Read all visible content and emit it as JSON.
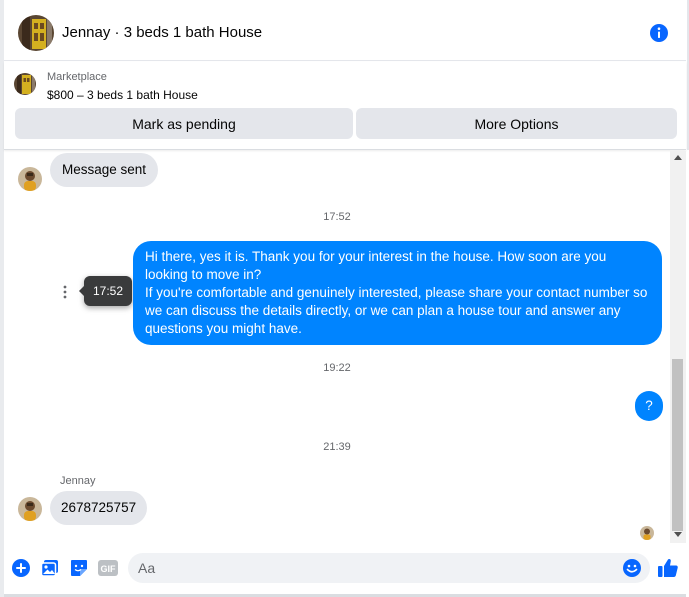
{
  "header": {
    "title": "Jennay · 3 beds 1 bath House"
  },
  "marketplace": {
    "label": "Marketplace",
    "item": "$800 – 3 beds 1 bath House",
    "pending_button": "Mark as pending",
    "more_button": "More Options"
  },
  "messages": {
    "sent_notice": "Message sent",
    "time_1": "17:52",
    "outgoing_1": "Hi there, yes it is. Thank you for your interest in the house. How soon are you looking to move in?\nIf you're comfortable and genuinely interested, please share your contact number so we can discuss the details directly, or we can plan a house tour and answer any questions you might have.",
    "tooltip_time": "17:52",
    "time_2": "19:22",
    "outgoing_2": "?",
    "time_3": "21:39",
    "sender": "Jennay",
    "incoming_phone": "2678725757"
  },
  "composer": {
    "placeholder": "Aa"
  },
  "colors": {
    "accent": "#0084ff",
    "bubble_in": "#e4e6eb",
    "icon_blue": "#0866ff"
  },
  "icons": [
    "info-icon",
    "plus-icon",
    "photo-icon",
    "sticker-icon",
    "gif-icon",
    "emoji-icon",
    "thumbs-up-icon",
    "more-dots-icon"
  ]
}
